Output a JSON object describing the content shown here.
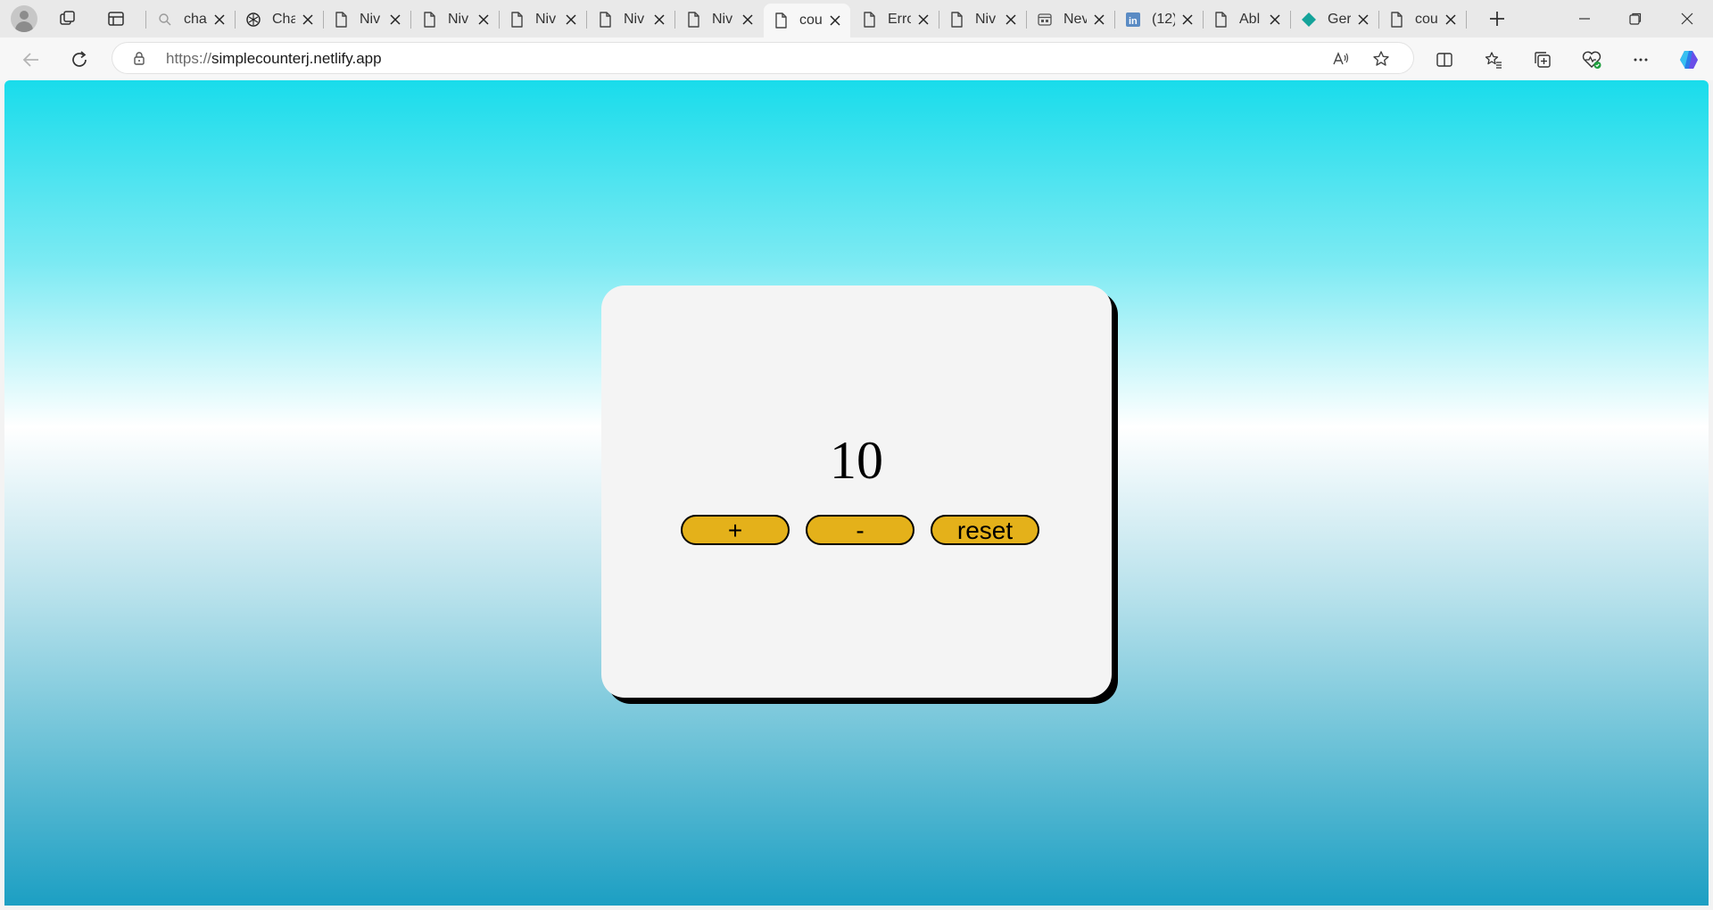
{
  "browser": {
    "tabs": [
      {
        "title": "cha",
        "icon": "search-icon",
        "active": false
      },
      {
        "title": "Cha",
        "icon": "openai-icon",
        "active": false
      },
      {
        "title": "Niv",
        "icon": "page-icon",
        "active": false
      },
      {
        "title": "Niv",
        "icon": "page-icon",
        "active": false
      },
      {
        "title": "Niv",
        "icon": "page-icon",
        "active": false
      },
      {
        "title": "Niv",
        "icon": "page-icon",
        "active": false
      },
      {
        "title": "Niv",
        "icon": "page-icon",
        "active": false
      },
      {
        "title": "cou",
        "icon": "page-icon",
        "active": true
      },
      {
        "title": "Erro",
        "icon": "page-icon",
        "active": false
      },
      {
        "title": "Niv",
        "icon": "page-icon",
        "active": false
      },
      {
        "title": "Nev",
        "icon": "newtab-icon",
        "active": false
      },
      {
        "title": "(12)",
        "icon": "linkedin-icon",
        "active": false
      },
      {
        "title": "Abl",
        "icon": "page-icon",
        "active": false
      },
      {
        "title": "Ger",
        "icon": "gemini-icon",
        "active": false
      },
      {
        "title": "cou",
        "icon": "page-icon",
        "active": false
      }
    ],
    "address": {
      "scheme": "https://",
      "host": "simplecounterj.netlify.app"
    }
  },
  "page": {
    "counter_value": "10",
    "buttons": {
      "increment": "+",
      "decrement": "-",
      "reset": "reset"
    },
    "colors": {
      "button_fill": "#e4b11a",
      "card_background": "#f4f4f4",
      "gradient_top": "#19dceb",
      "gradient_bottom": "#1c9fc3"
    }
  }
}
